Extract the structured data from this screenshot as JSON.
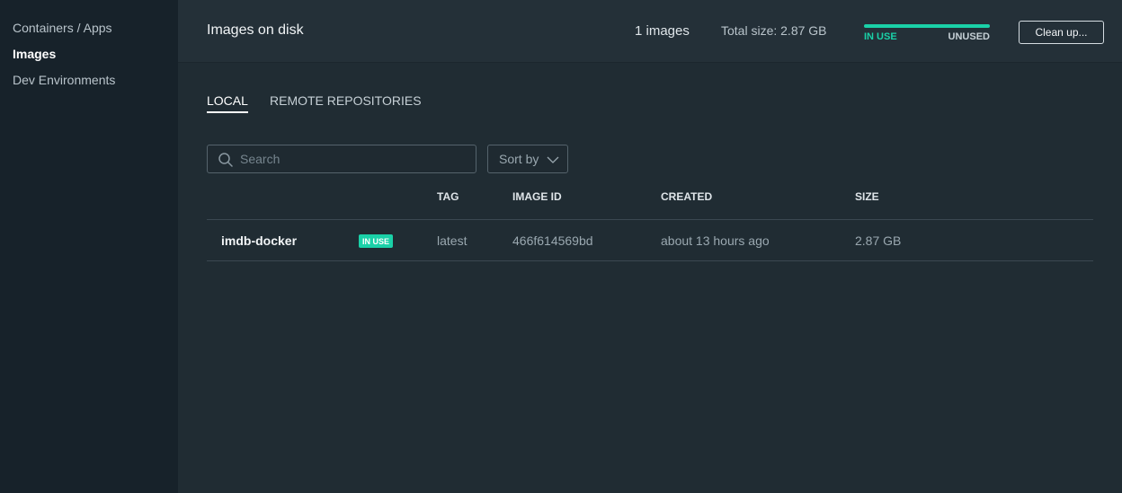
{
  "sidebar": {
    "items": [
      {
        "label": "Containers / Apps"
      },
      {
        "label": "Images"
      },
      {
        "label": "Dev Environments"
      }
    ]
  },
  "header": {
    "title": "Images on disk",
    "count": "1 images",
    "total_size": "Total size: 2.87 GB",
    "usage": {
      "in_use_label": "IN USE",
      "unused_label": "UNUSED",
      "in_use_fraction": 1.0
    },
    "cleanup_label": "Clean up..."
  },
  "tabs": [
    {
      "label": "LOCAL"
    },
    {
      "label": "REMOTE REPOSITORIES"
    }
  ],
  "search": {
    "placeholder": "Search",
    "value": ""
  },
  "sort": {
    "label": "Sort by"
  },
  "table": {
    "columns": [
      "TAG",
      "IMAGE ID",
      "CREATED",
      "SIZE"
    ],
    "rows": [
      {
        "name": "imdb-docker",
        "badge": "IN USE",
        "tag": "latest",
        "image_id": "466f614569bd",
        "created": "about 13 hours ago",
        "size": "2.87 GB"
      }
    ]
  },
  "colors": {
    "accent": "#1ad1a8",
    "sidebar_bg": "#17222a",
    "main_bg": "#202c33",
    "header_bg": "#243038"
  },
  "icons": {
    "search": "search-icon",
    "sort": "chevron-down-icon"
  }
}
